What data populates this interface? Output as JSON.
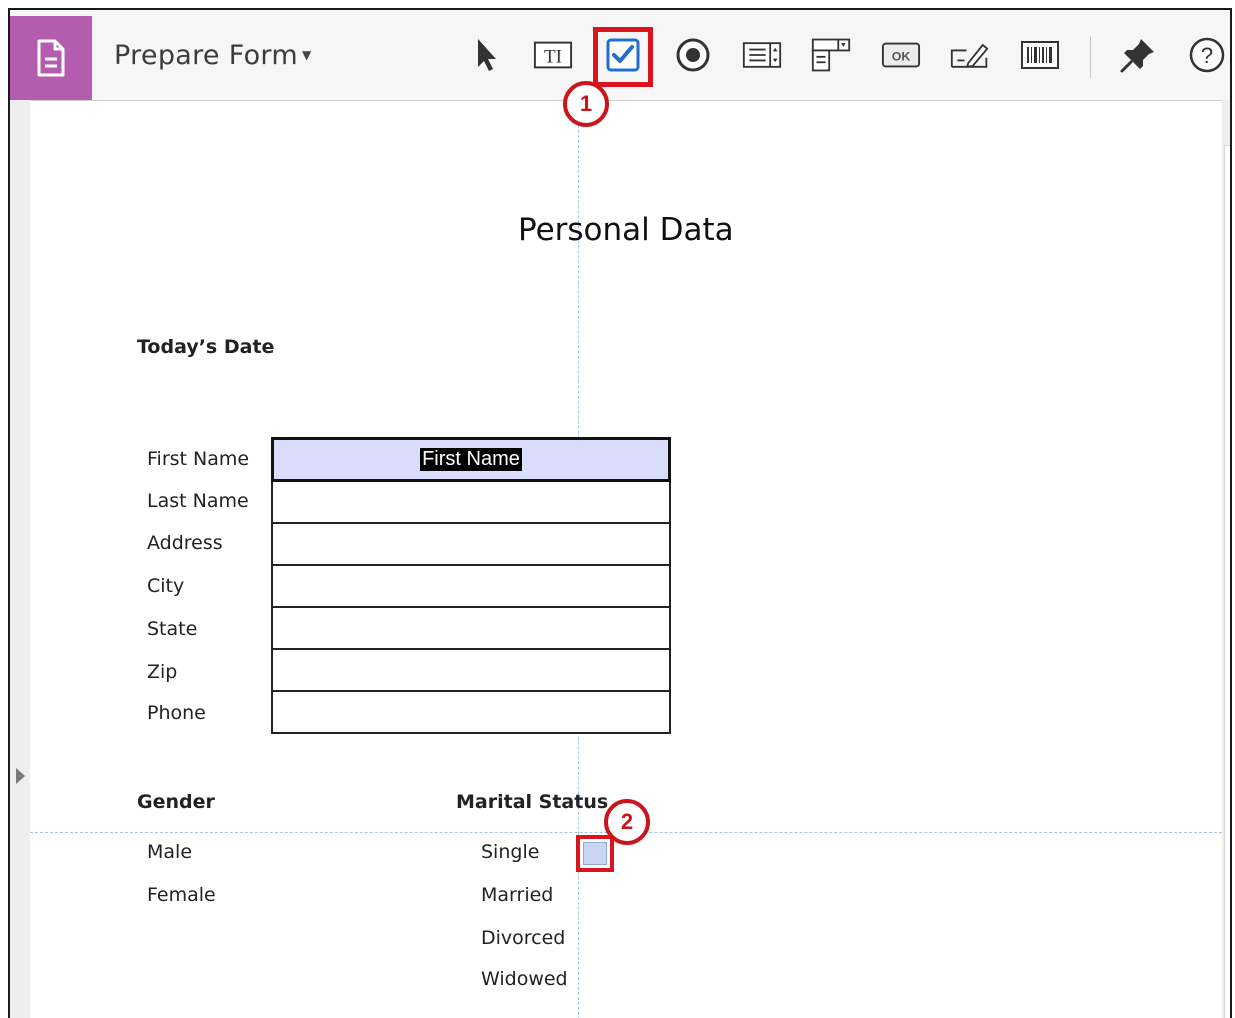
{
  "toolbar": {
    "title": "Prepare Form",
    "tools": [
      {
        "name": "select-tool",
        "icon": "arrow-pointer-icon"
      },
      {
        "name": "text-field-tool",
        "icon": "text-field-icon"
      },
      {
        "name": "checkbox-tool",
        "icon": "checkbox-icon",
        "selected": true
      },
      {
        "name": "radio-button-tool",
        "icon": "radio-button-icon"
      },
      {
        "name": "list-box-tool",
        "icon": "list-box-icon"
      },
      {
        "name": "dropdown-tool",
        "icon": "dropdown-icon"
      },
      {
        "name": "button-tool",
        "icon": "button-icon",
        "label": "OK"
      },
      {
        "name": "signature-tool",
        "icon": "signature-icon"
      },
      {
        "name": "barcode-tool",
        "icon": "barcode-icon"
      },
      {
        "name": "pin-tool",
        "icon": "pin-icon"
      },
      {
        "name": "help-tool",
        "icon": "help-icon",
        "label": "?"
      }
    ]
  },
  "callouts": {
    "one": "1",
    "two": "2"
  },
  "colors": {
    "accent": "#b45cae",
    "highlight": "#d9141c",
    "selected_blue": "#1f6fd1",
    "field_fill": "#d9dcfb"
  },
  "document": {
    "title": "Personal Data",
    "date_label": "Today’s Date",
    "fields": {
      "labels": [
        "First Name",
        "Last Name",
        "Address",
        "City",
        "State",
        "Zip",
        "Phone"
      ],
      "first_name_value": "First Name"
    },
    "gender": {
      "label": "Gender",
      "options": [
        "Male",
        "Female"
      ]
    },
    "marital": {
      "label": "Marital Status",
      "options": [
        "Single",
        "Married",
        "Divorced",
        "Widowed"
      ]
    }
  }
}
